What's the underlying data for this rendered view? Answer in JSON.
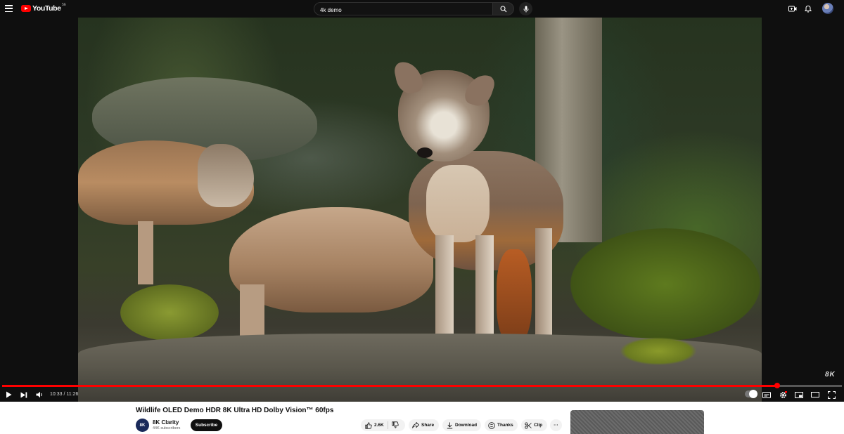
{
  "header": {
    "logo_text": "YouTube",
    "logo_country": "SE",
    "search_value": "4k demo",
    "icons": [
      "menu-icon",
      "search-icon",
      "mic-icon",
      "create-icon",
      "bell-icon",
      "avatar"
    ]
  },
  "player": {
    "watermark": "8K",
    "time_current": "10:33",
    "time_separator": " / ",
    "time_total": "11:26",
    "progress_fraction": 0.923,
    "colors": {
      "progress": "#ff0000",
      "background": "#0f0f0f"
    }
  },
  "video": {
    "title": "Wildlife OLED Demo HDR 8K Ultra HD Dolby Vision™ 60fps",
    "channel_avatar_text": "8K",
    "channel_name": "8K Clarity",
    "subscribers": "44K subscribers",
    "subscribe_label": "Subscribe",
    "like_count": "2.6K",
    "share_label": "Share",
    "download_label": "Download",
    "thanks_label": "Thanks",
    "clip_label": "Clip",
    "more_label": "···"
  }
}
